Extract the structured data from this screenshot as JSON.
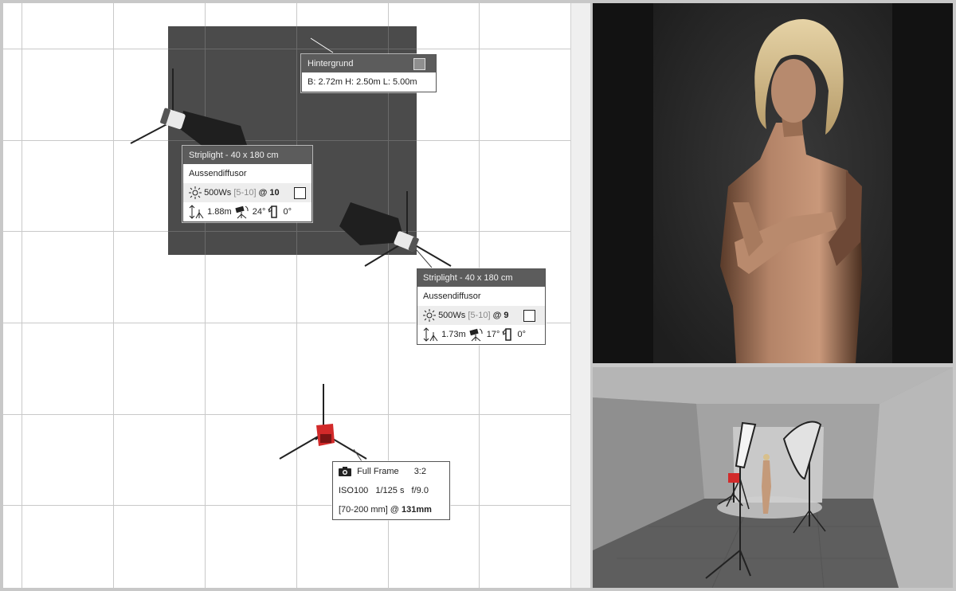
{
  "backdrop": {
    "title": "Hintergrund",
    "dimensions": "B: 2.72m H: 2.50m L: 5.00m",
    "color": "#8f8f8f"
  },
  "lights": [
    {
      "title": "Striplight - 40 x 180 cm",
      "modifier": "Aussendiffusor",
      "power": "500Ws",
      "range": "[5-10]",
      "at": "@",
      "level": "10",
      "height": "1.88m",
      "tilt": "24°",
      "rotation": "0°"
    },
    {
      "title": "Striplight - 40 x 180 cm",
      "modifier": "Aussendiffusor",
      "power": "500Ws",
      "range": "[5-10]",
      "at": "@",
      "level": "9",
      "height": "1.73m",
      "tilt": "17°",
      "rotation": "0°"
    }
  ],
  "camera": {
    "sensor": "Full Frame",
    "ratio": "3:2",
    "iso": "ISO100",
    "shutter": "1/125 s",
    "aperture": "f/9.0",
    "lens": "[70-200 mm] @",
    "focal": "131mm",
    "body_color": "#d22a2a"
  },
  "icons": {
    "power": "sun-icon",
    "height": "height-arrows-icon",
    "tilt": "tilt-head-icon",
    "rotation": "rotation-icon",
    "camera": "camera-icon"
  }
}
